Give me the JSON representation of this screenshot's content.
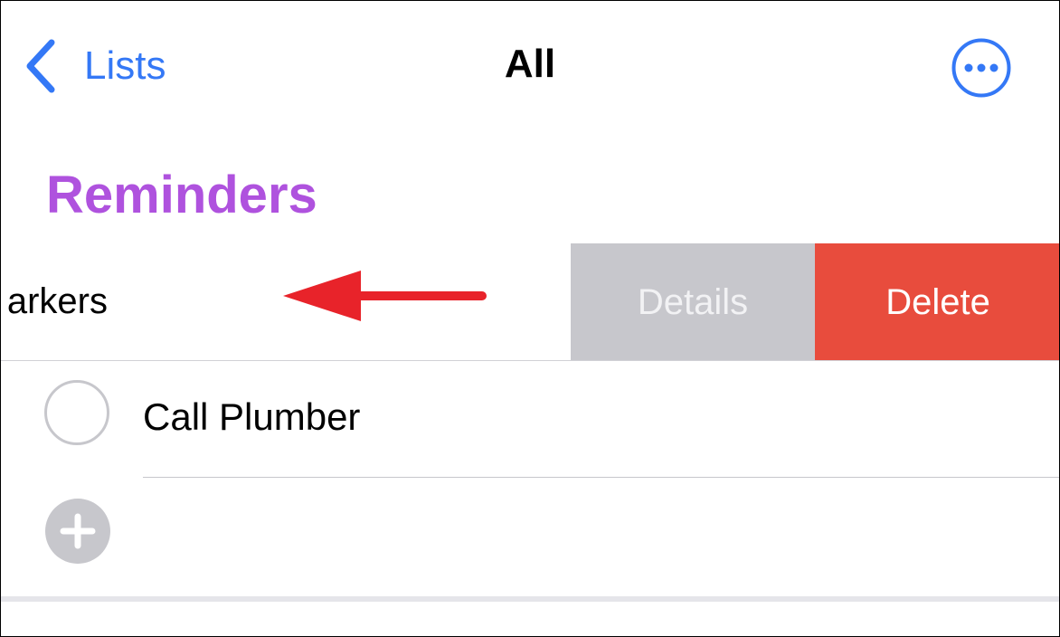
{
  "nav": {
    "back_label": "Lists",
    "title": "All",
    "back_icon": "chevron-left-icon",
    "more_icon": "ellipsis-circle-icon"
  },
  "section": {
    "title": "Reminders",
    "color": "#af52de"
  },
  "swiped_row": {
    "visible_text": "arkers",
    "actions": {
      "details_label": "Details",
      "details_color": "#c7c7cc",
      "delete_label": "Delete",
      "delete_color": "#e84c3d"
    }
  },
  "reminders": [
    {
      "title": "Call Plumber",
      "completed": false
    }
  ],
  "add_button": {
    "icon": "plus-circle-icon"
  },
  "annotation": {
    "icon": "red-arrow-left-icon",
    "color": "#e8232a"
  },
  "colors": {
    "accent": "#3478f6"
  }
}
